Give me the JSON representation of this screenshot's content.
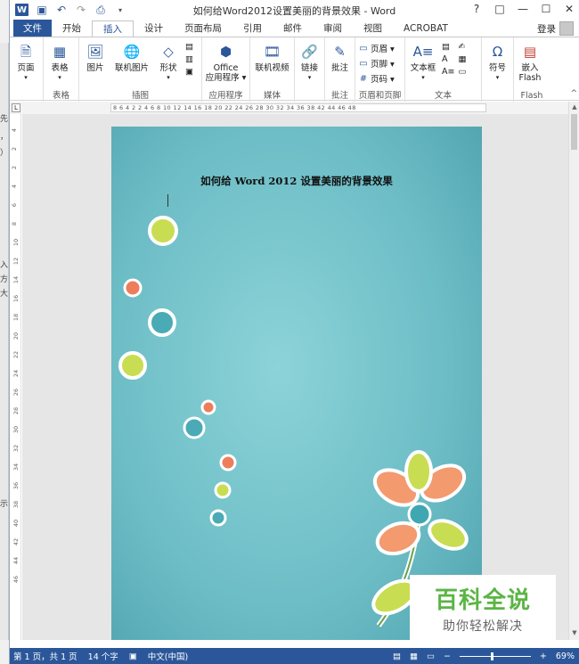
{
  "window": {
    "title": "如何给Word2012设置美丽的背景效果 - Word"
  },
  "titlebar": {
    "help": "?",
    "restore": "□",
    "minimize": "—",
    "maximize": "☐",
    "close": "✕",
    "login": "登录"
  },
  "tabs": [
    {
      "label": "文件",
      "kind": "file"
    },
    {
      "label": "开始",
      "kind": ""
    },
    {
      "label": "插入",
      "kind": "active"
    },
    {
      "label": "设计",
      "kind": ""
    },
    {
      "label": "页面布局",
      "kind": ""
    },
    {
      "label": "引用",
      "kind": ""
    },
    {
      "label": "邮件",
      "kind": ""
    },
    {
      "label": "审阅",
      "kind": ""
    },
    {
      "label": "视图",
      "kind": ""
    },
    {
      "label": "ACROBAT",
      "kind": ""
    }
  ],
  "ribbon": {
    "pages": {
      "label": "页面",
      "group": ""
    },
    "tables": {
      "label": "表格",
      "group": "表格"
    },
    "illustrations": {
      "picture": "图片",
      "online_picture": "联机图片",
      "shapes": "形状",
      "group": "插图"
    },
    "apps": {
      "office": "Office",
      "app_store": "应用程序 ▾",
      "group": "应用程序"
    },
    "media": {
      "online_video": "联机视频",
      "group": "媒体"
    },
    "links": {
      "label": "链接"
    },
    "comments": {
      "label": "批注",
      "group": "批注"
    },
    "header_footer": {
      "header": "页眉 ▾",
      "footer": "页脚 ▾",
      "page_number": "页码 ▾",
      "group": "页眉和页脚"
    },
    "text": {
      "textbox": "文本框",
      "group": "文本"
    },
    "symbols": {
      "label": "符号"
    },
    "flash": {
      "label1": "嵌入",
      "label2": "Flash",
      "group": "Flash"
    }
  },
  "ruler": {
    "corner": "L",
    "horizontal": "8  6  4  2     2   4   6   8  10  12  14  16  18  20  22  24  26  28  30  32  34  36  38     42  44  46  48",
    "vertical": [
      "4",
      "2",
      "2",
      "4",
      "6",
      "8",
      "10",
      "12",
      "14",
      "16",
      "18",
      "20",
      "22",
      "24",
      "26",
      "28",
      "30",
      "32",
      "34",
      "36",
      "38",
      "40",
      "42",
      "44",
      "46"
    ]
  },
  "document": {
    "title": "如何给 Word 2012 设置美丽的背景效果"
  },
  "status": {
    "pages": "第 1 页，共 1 页",
    "words": "14 个字",
    "language": "中文(中国)",
    "zoom": "69%",
    "zoom_fraction": 0.45
  },
  "left_strip": [
    "先",
    "，",
    "）",
    "入",
    "方",
    "大",
    "示"
  ],
  "watermark": {
    "title": "百科全说",
    "subtitle": "助你轻松解决"
  },
  "colors": {
    "accent": "#2b579a",
    "page_bg": "#72c1c9",
    "watermark_green": "#5bb545"
  }
}
